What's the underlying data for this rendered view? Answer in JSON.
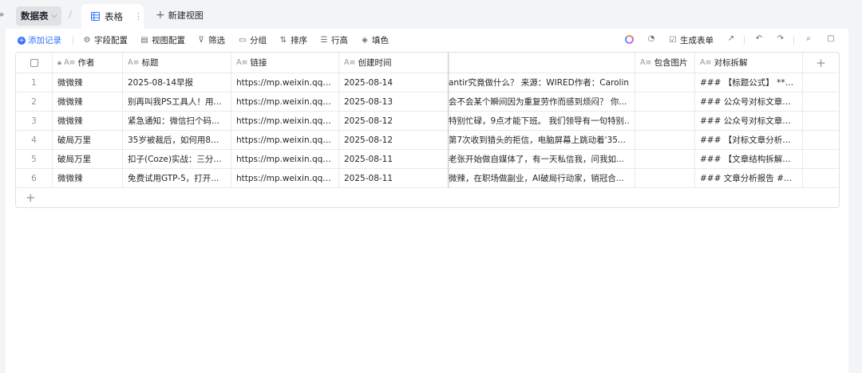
{
  "topbar": {
    "expand_icon": "»",
    "db_name": "数据表",
    "db_chevron": "⌵",
    "separator": "/",
    "active_tab": "表格",
    "tab_menu_icon": "⋮",
    "new_view_icon": "+",
    "new_view_label": "新建视图"
  },
  "toolbar": {
    "add_record": "添加记录",
    "field_config": "字段配置",
    "view_config": "视图配置",
    "filter": "筛选",
    "group": "分组",
    "sort": "排序",
    "row_height": "行高",
    "fill": "填色",
    "generate_form": "生成表单"
  },
  "table": {
    "headers": {
      "author": "作者",
      "title": "标题",
      "link": "链接",
      "created": "创建时间",
      "contains_image": "包含图片",
      "analysis": "对标拆解"
    },
    "rows": [
      {
        "num": "1",
        "author": "微微辣",
        "title": "2025-08-14早报",
        "link": "https://mp.weixin.qq.co...",
        "created": "2025-08-14",
        "content": "antir究竟做什么？ 来源：WIRED作者：Carolin...",
        "image": "",
        "analysis": "### 【标题公式】 **{热..."
      },
      {
        "num": "2",
        "author": "微微辣",
        "title": "别再叫我PS工具人！用...",
        "link": "https://mp.weixin.qq.co...",
        "created": "2025-08-13",
        "content": "会不会某个瞬间因为重复劳作而感到烦闷？ 你...",
        "image": "",
        "analysis": "### 公众号对标文章分..."
      },
      {
        "num": "3",
        "author": "微微辣",
        "title": "紧急通知：微信扫个码...",
        "link": "https://mp.weixin.qq.co...",
        "created": "2025-08-12",
        "content": "特别忙碌，9点才能下班。 我们领导有一句特别...",
        "image": "",
        "analysis": "### 公众号对标文章分..."
      },
      {
        "num": "4",
        "author": "破局万里",
        "title": "35岁被裁后，如何用8年...",
        "link": "https://mp.weixin.qq.co...",
        "created": "2025-08-12",
        "content": "第7次收到猎头的拒信，电脑屏幕上跳动着'35...",
        "image": "",
        "analysis": "### 【对标文章分析报..."
      },
      {
        "num": "5",
        "author": "破局万里",
        "title": "扣子(Coze)实战：三分...",
        "link": "https://mp.weixin.qq.co...",
        "created": "2025-08-11",
        "content": "老张开始做自媒体了，有一天私信我，问我如...",
        "image": "",
        "analysis": "### 【文章结构拆解】 ..."
      },
      {
        "num": "6",
        "author": "微微辣",
        "title": "免费试用GTP-5，打开...",
        "link": "https://mp.weixin.qq.co...",
        "created": "2025-08-11",
        "content": "微辣，在职场做副业，AI破局行动家，销冠合...",
        "image": "",
        "analysis": "### 文章分析报告 ###..."
      }
    ]
  },
  "icons": {
    "add": "+",
    "add_row": "+",
    "add_column": "+"
  }
}
